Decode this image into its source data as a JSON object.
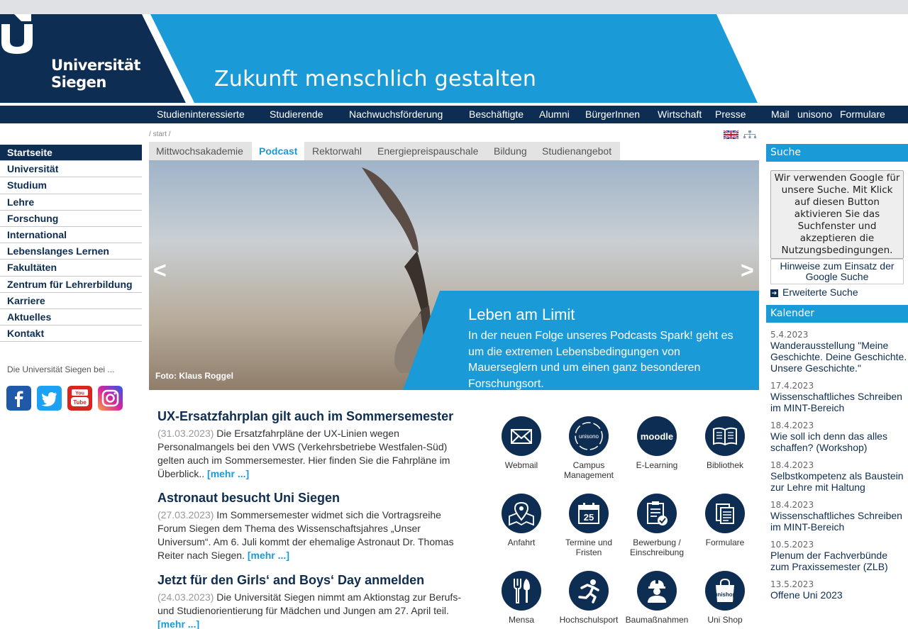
{
  "header": {
    "logo_line1": "Universität",
    "logo_line2": "Siegen",
    "slogan": "Zukunft menschlich gestalten",
    "colors": {
      "navy": "#0d2d52",
      "cyan": "#1a9bd7"
    }
  },
  "mainnav": {
    "items": [
      "Studieninteressierte",
      "Studierende",
      "Nachwuchsförderung",
      "Beschäftigte",
      "Alumni",
      "BürgerInnen",
      "Wirtschaft",
      "Presse"
    ],
    "service": [
      "Mail",
      "unisono",
      "Formulare"
    ]
  },
  "breadcrumb": {
    "sep": "/",
    "item": "start"
  },
  "sidebar": {
    "items": [
      "Startseite",
      "Universität",
      "Studium",
      "Lehre",
      "Forschung",
      "International",
      "Lebenslanges Lernen",
      "Fakultäten",
      "Zentrum für Lehrerbildung",
      "Karriere",
      "Aktuelles",
      "Kontakt"
    ],
    "social_title": "Die Universität Siegen bei ...",
    "social_icons": [
      "facebook-icon",
      "twitter-icon",
      "youtube-icon",
      "instagram-icon"
    ]
  },
  "tabs": [
    "Mittwochsakademie",
    "Podcast",
    "Rektorwahl",
    "Energiepreispauschale",
    "Bildung",
    "Studienangebot"
  ],
  "slider": {
    "prev": "<",
    "next": ">",
    "photo_credit": "Foto: Klaus Roggel",
    "title": "Leben am Limit",
    "text": "In der neuen Folge unseres Podcasts Spark! geht es um die extremen Lebensbedingungen von Mauerseglern und um einen ganz besonderen Forschungsort."
  },
  "news": [
    {
      "title": "UX-Ersatzfahrplan gilt auch im Sommersemester",
      "date": "(31.03.2023)",
      "text": "Die Ersatzfahrpläne der UX-Linien wegen Personalmangels bei den VWS (Verkehrsbetriebe Westfalen-Süd) gelten auch im Sommersemester. Hier finden Sie die Fahrpläne im Überblick..",
      "more": "[mehr ...]"
    },
    {
      "title": "Astronaut besucht Uni Siegen",
      "date": "(27.03.2023)",
      "text": "Im Sommersemester widmet sich die Vortragsreihe Forum Siegen dem Thema des Wissenschaftsjahres „Unser Universum“. Am 6. Juli kommt der ehemalige Astronaut Dr. Thomas Reiter nach Siegen.",
      "more": "[mehr ...]"
    },
    {
      "title": "Jetzt für den Girls‘ and Boys‘ Day anmelden",
      "date": "(24.03.2023)",
      "text": "Die Universität Siegen nimmt am Aktionstag zur Berufs- und Studienorientierung für Mädchen und Jungen am 27. April teil.",
      "more": "[mehr ...]"
    }
  ],
  "quicklinks": [
    {
      "label": "Webmail",
      "icon": "mail-icon"
    },
    {
      "label": "Campus Management",
      "icon": "unisono-icon",
      "icon_text": "unisono"
    },
    {
      "label": "E-Learning",
      "icon": "moodle-icon",
      "icon_text": "moodle"
    },
    {
      "label": "Bibliothek",
      "icon": "book-icon"
    },
    {
      "label": "Anfahrt",
      "icon": "map-pin-icon"
    },
    {
      "label": "Termine und Fristen",
      "icon": "calendar-icon",
      "icon_text": "25"
    },
    {
      "label": "Bewerbung / Einschreibung",
      "icon": "application-icon"
    },
    {
      "label": "Formulare",
      "icon": "forms-icon"
    },
    {
      "label": "Mensa",
      "icon": "cutlery-icon"
    },
    {
      "label": "Hochschulsport",
      "icon": "runner-icon"
    },
    {
      "label": "Baumaßnahmen",
      "icon": "worker-icon"
    },
    {
      "label": "Uni Shop",
      "icon": "shop-bag-icon",
      "icon_text": "unishop"
    }
  ],
  "search": {
    "heading": "Suche",
    "google_button": "Wir verwenden Google für unsere Suche. Mit Klick auf diesen Button aktivieren Sie das Suchfenster und akzeptieren die Nutzungsbedingungen.",
    "hint_link": "Hinweise zum Einsatz der Google Suche",
    "advanced": "Erweiterte Suche"
  },
  "calendar": {
    "heading": "Kalender",
    "events": [
      {
        "date": "5.4.2023",
        "title": "Wanderausstellung \"Meine Geschichte. Deine Geschichte. Unsere Geschichte.\""
      },
      {
        "date": "17.4.2023",
        "title": "Wissenschaftliches Schreiben im MINT-Bereich"
      },
      {
        "date": "18.4.2023",
        "title": "Wie soll ich denn das alles schaffen? (Workshop)"
      },
      {
        "date": "18.4.2023",
        "title": "Selbstkompetenz als Baustein zur Lehre mit Haltung"
      },
      {
        "date": "18.4.2023",
        "title": "Wissenschaftliches Schreiben im MINT-Bereich"
      },
      {
        "date": "10.5.2023",
        "title": "Plenum der Fachverbünde zum Praxissemester (ZLB)"
      },
      {
        "date": "13.5.2023",
        "title": "Offene Uni 2023"
      }
    ]
  }
}
